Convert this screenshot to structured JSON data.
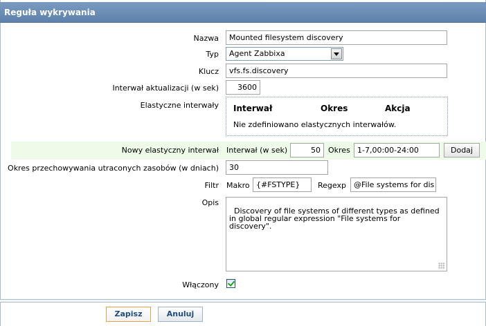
{
  "form": {
    "title": "Reguła wykrywania",
    "name_label": "Nazwa",
    "name_value": "Mounted filesystem discovery",
    "type_label": "Typ",
    "type_value": "Agent Zabbixa",
    "key_label": "Klucz",
    "key_value": "vfs.fs.discovery",
    "interval_label": "Interwał aktualizacji (w sek)",
    "interval_value": "3600",
    "flex_label": "Elastyczne interwały",
    "flex_headers": {
      "interval": "Interwał",
      "period": "Okres",
      "action": "Akcja"
    },
    "flex_empty": "Nie zdefiniowano elastycznych interwałów.",
    "new_flex_label": "Nowy elastyczny interwał",
    "new_flex_interval_label": "Interwał (w sek)",
    "new_flex_interval_value": "50",
    "new_flex_period_label": "Okres",
    "new_flex_period_value": "1-7,00:00-24:00",
    "add_button": "Dodaj",
    "lifetime_label": "Okres przechowywania utraconych zasobów (w dniach)",
    "lifetime_value": "30",
    "filter_label": "Filtr",
    "macro_label": "Makro",
    "macro_value": "{#FSTYPE}",
    "regexp_label": "Regexp",
    "regexp_value": "@File systems for dis",
    "description_label": "Opis",
    "description_value": "Discovery of file systems of different types as defined\nin global regular expression \"File systems for\ndiscovery\".",
    "enabled_label": "Włączony",
    "enabled": true,
    "save_button": "Zapisz",
    "cancel_button": "Anuluj"
  },
  "colors": {
    "title_bar": "#6b8db6",
    "new_flex_row": "#eefbe9",
    "save_border": "#e8a249",
    "checkmark": "#21a121"
  }
}
